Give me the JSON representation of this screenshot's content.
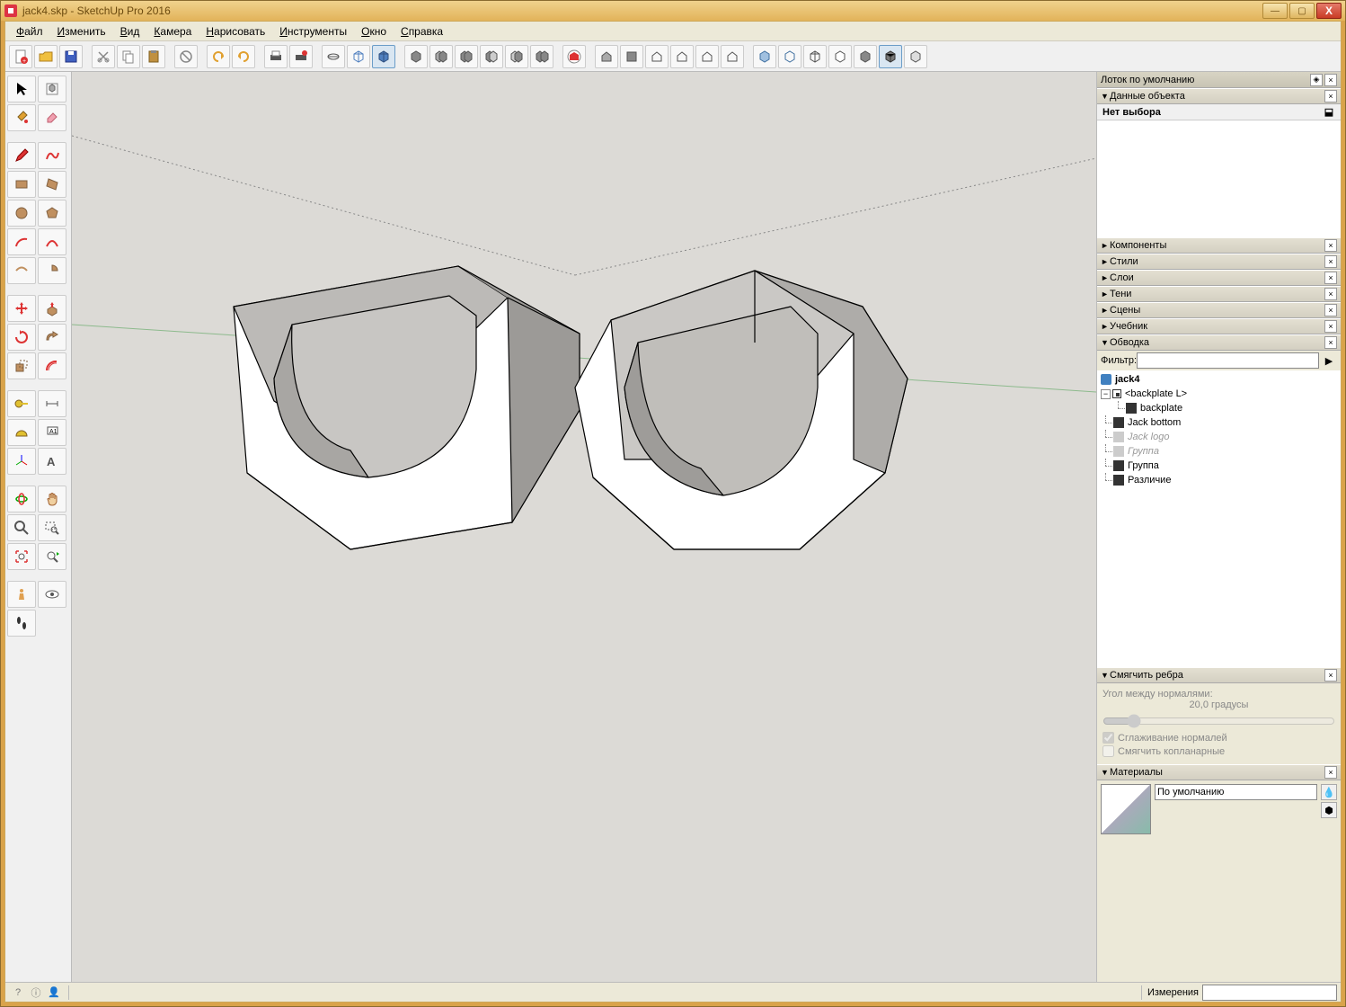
{
  "title": "jack4.skp - SketchUp Pro 2016",
  "menus": {
    "file": "Файл",
    "edit": "Изменить",
    "view": "Вид",
    "camera": "Камера",
    "draw": "Нарисовать",
    "tools": "Инструменты",
    "window": "Окно",
    "help": "Справка"
  },
  "tray": {
    "title": "Лоток по умолчанию",
    "entity": {
      "header": "Данные объекта",
      "no_selection": "Нет выбора"
    },
    "components": "Компоненты",
    "styles": "Стили",
    "layers": "Слои",
    "shadows": "Тени",
    "scenes": "Сцены",
    "instructor": "Учебник",
    "outliner": {
      "header": "Обводка",
      "filter_label": "Фильтр:"
    },
    "soften": {
      "header": "Смягчить ребра",
      "angle_label": "Угол между нормалями:",
      "angle_value": "20,0  градусы",
      "smooth_normals": "Сглаживание нормалей",
      "soften_coplanar": "Смягчить копланарные"
    },
    "materials": {
      "header": "Материалы",
      "name": "По умолчанию"
    }
  },
  "outliner_tree": {
    "root": "jack4",
    "items": [
      {
        "label": "<backplate L>",
        "kind": "comp",
        "expanded": true,
        "children": [
          {
            "label": "backplate",
            "kind": "group"
          }
        ]
      },
      {
        "label": "Jack bottom",
        "kind": "group"
      },
      {
        "label": "Jack logo",
        "kind": "group",
        "grey": true
      },
      {
        "label": "Группа",
        "kind": "group",
        "grey": true
      },
      {
        "label": "Группа",
        "kind": "group"
      },
      {
        "label": "Различие",
        "kind": "group"
      }
    ]
  },
  "status": {
    "measurements_label": "Измерения"
  },
  "icons": {
    "min": "—",
    "max": "▢",
    "close": "X",
    "pin": "◈",
    "x": "×",
    "arrow_r": "►",
    "arrow_d": "▼",
    "bolt": "⬇",
    "plus": "+",
    "minus": "−"
  }
}
